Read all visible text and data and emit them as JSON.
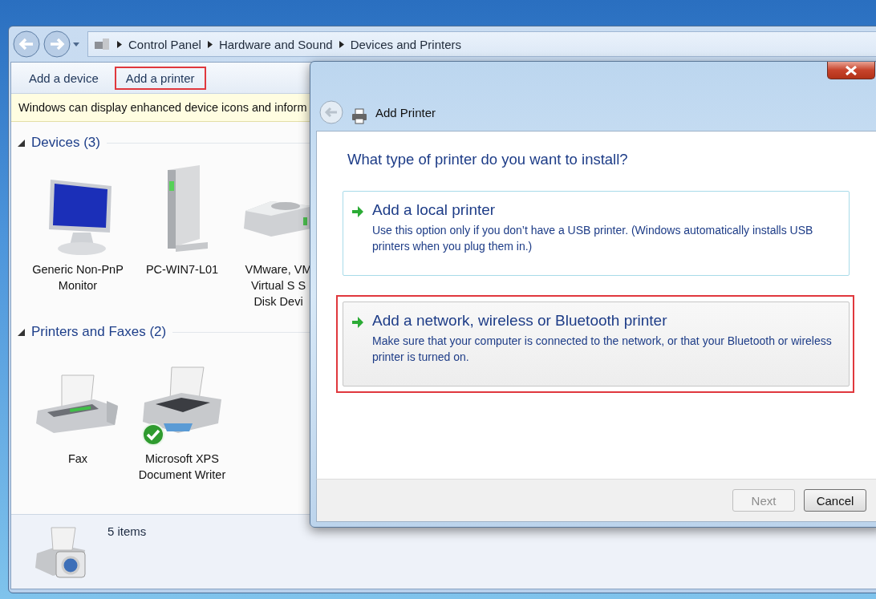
{
  "address_bar": {
    "breadcrumbs": [
      "Control Panel",
      "Hardware and Sound",
      "Devices and Printers"
    ]
  },
  "toolbar": [
    {
      "label": "Add a device",
      "highlighted": false
    },
    {
      "label": "Add a printer",
      "highlighted": true
    }
  ],
  "info_bar": {
    "text": "Windows can display enhanced device icons and inform"
  },
  "groups": [
    {
      "title": "Devices (3)",
      "expanded": true,
      "items": [
        {
          "kind": "monitor",
          "label": "Generic Non-PnP\nMonitor"
        },
        {
          "kind": "computer",
          "label": "PC-WIN7-L01"
        },
        {
          "kind": "drive",
          "label": "VMware, VM\nVirtual S S\nDisk Devi"
        }
      ]
    },
    {
      "title": "Printers and Faxes (2)",
      "expanded": true,
      "items": [
        {
          "kind": "fax",
          "label": "Fax"
        },
        {
          "kind": "printer",
          "label": "Microsoft XPS\nDocument Writer",
          "default": true
        }
      ]
    }
  ],
  "status_bar": {
    "count": "5 items"
  },
  "dialog": {
    "title": "Add Printer",
    "heading": "What type of printer do you want to install?",
    "options": [
      {
        "title": "Add a local printer",
        "description": "Use this option only if you don’t have a USB printer. (Windows automatically installs USB printers when you plug them in.)",
        "selected": false,
        "highlighted": false
      },
      {
        "title": "Add a network, wireless or Bluetooth printer",
        "description": "Make sure that your computer is connected to the network, or that your Bluetooth or wireless printer is turned on.",
        "selected": true,
        "highlighted": true
      }
    ],
    "buttons": [
      {
        "label": "Next",
        "disabled": true
      },
      {
        "label": "Cancel",
        "disabled": false
      }
    ]
  }
}
